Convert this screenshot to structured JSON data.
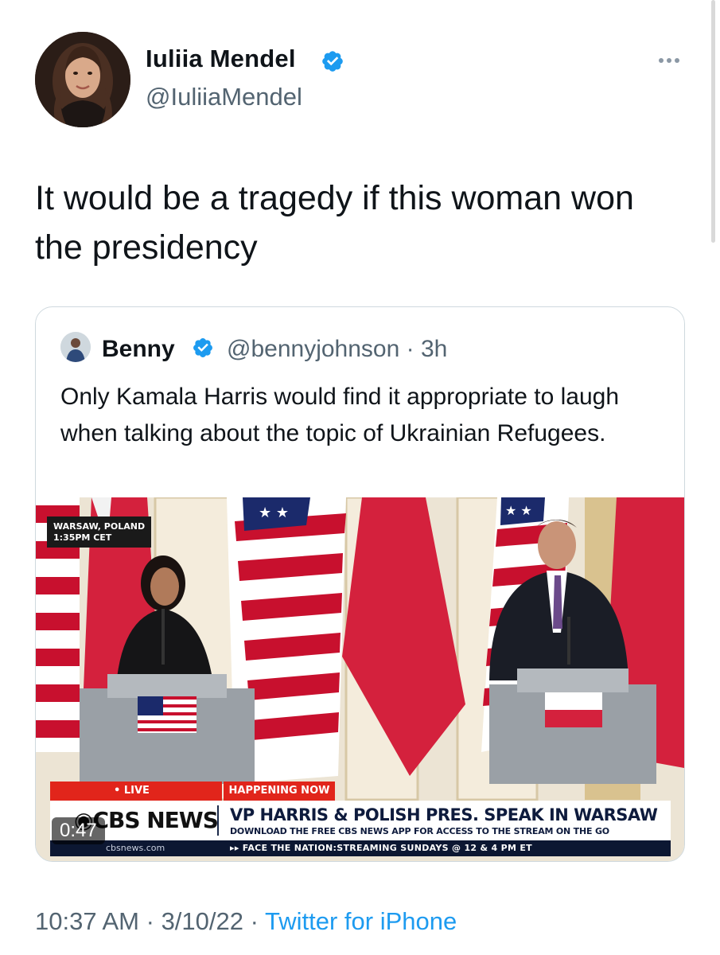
{
  "tweet": {
    "author": {
      "name": "Iuliia Mendel",
      "handle": "@IuliiaMendel",
      "verified": true
    },
    "more_icon": "more-horizontal-icon",
    "text": "It would be a tragedy if this woman won the presidency",
    "time": "10:37 AM",
    "date": "3/10/22",
    "source": "Twitter for iPhone",
    "separator": "·"
  },
  "quote": {
    "author": {
      "name": "Benny",
      "handle": "@bennyjohnson",
      "time_ago": "3h",
      "verified": true
    },
    "text": "Only Kamala Harris would find it appropriate to laugh when talking about the topic of Ukrainian Refugees.",
    "video": {
      "duration": "0:47",
      "dateline_line1": "WARSAW, POLAND",
      "dateline_line2": "1:35PM CET",
      "live_label": "• LIVE",
      "happening_label": "HAPPENING NOW",
      "network": "CBS NEWS",
      "headline": "VP HARRIS & POLISH PRES. SPEAK IN WARSAW",
      "subline": "DOWNLOAD THE FREE CBS NEWS APP FOR ACCESS TO THE STREAM ON THE GO",
      "site": "cbsnews.com",
      "ticker": "▸▸ FACE THE NATION:STREAMING SUNDAYS @ 12 & 4 PM ET"
    }
  },
  "colors": {
    "verified_blue": "#1d9bf0",
    "text_primary": "#0f1419",
    "text_secondary": "#536471",
    "link": "#1d9bf0",
    "cbs_red": "#e1251b",
    "cbs_navy": "#0c1732"
  }
}
